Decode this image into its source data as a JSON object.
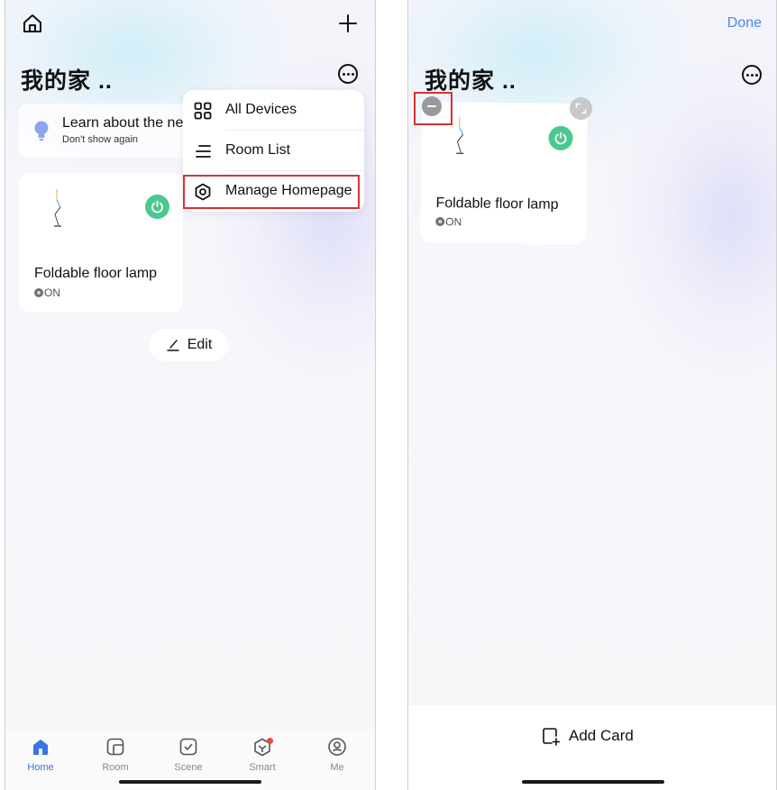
{
  "left": {
    "title": "我的家 ..",
    "tip": {
      "title": "Learn about the ne",
      "subtitle": "Don't show again"
    },
    "card": {
      "name": "Foldable floor lamp",
      "status": "ON"
    },
    "edit_label": "Edit",
    "menu": {
      "items": [
        {
          "label": "All Devices",
          "icon": "grid-icon"
        },
        {
          "label": "Room List",
          "icon": "list-icon"
        },
        {
          "label": "Manage Homepage",
          "icon": "hexagon-settings-icon"
        }
      ],
      "highlighted": "Manage Homepage"
    },
    "tabs": [
      {
        "label": "Home",
        "icon": "home-icon",
        "active": true
      },
      {
        "label": "Room",
        "icon": "room-icon",
        "active": false
      },
      {
        "label": "Scene",
        "icon": "scene-icon",
        "active": false
      },
      {
        "label": "Smart",
        "icon": "smart-icon",
        "active": false,
        "badge": true
      },
      {
        "label": "Me",
        "icon": "me-icon",
        "active": false
      }
    ]
  },
  "right": {
    "title": "我的家 ..",
    "done_label": "Done",
    "card": {
      "name": "Foldable floor lamp",
      "status": "ON"
    },
    "add_card_label": "Add Card"
  },
  "colors": {
    "accent": "#3a72e8",
    "done": "#4a86e8",
    "power": "#4cc790",
    "highlight": "#d9322f",
    "badge": "#f0473d"
  }
}
